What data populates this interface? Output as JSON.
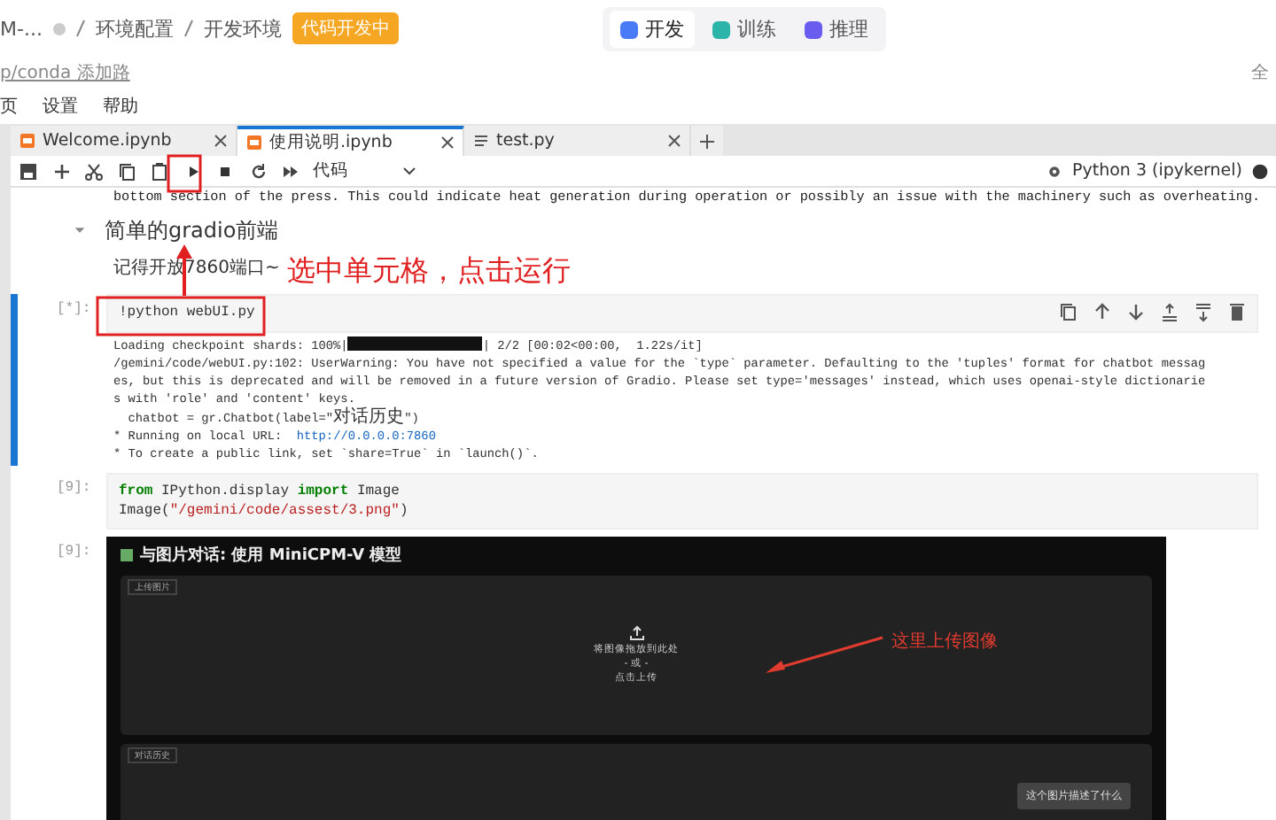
{
  "header": {
    "project": "M-...",
    "breadcrumbs": [
      "环境配置",
      "开发环境"
    ],
    "status_badge": "代码开发中",
    "modes": [
      {
        "label": "开发",
        "selected": true
      },
      {
        "label": "训练",
        "selected": false
      },
      {
        "label": "推理",
        "selected": false
      }
    ]
  },
  "env_link": "p/conda 添加路",
  "right_edge_label": "全",
  "menu": [
    "页",
    "设置",
    "帮助"
  ],
  "tabs": [
    {
      "label": "Welcome.ipynb",
      "kind": "notebook",
      "selected": false
    },
    {
      "label": "使用说明.ipynb",
      "kind": "notebook",
      "selected": true
    },
    {
      "label": "test.py",
      "kind": "file",
      "selected": false
    }
  ],
  "toolbar": {
    "cell_type": "代码",
    "kernel": "Python 3 (ipykernel)"
  },
  "notebook": {
    "prev_output": "bottom section of the press. This could indicate heat generation during operation or possibly an issue with the machinery such as overheating.",
    "heading": "简单的gradio前端",
    "note": "记得开放7860端口~",
    "run_cell": {
      "prompt": "[*]:",
      "code": "!python webUI.py",
      "selected": true,
      "output": [
        [
          {
            "kind": "text",
            "text": "Loading checkpoint shards: 100%|"
          },
          {
            "kind": "bar",
            "level": 1
          },
          {
            "kind": "text",
            "text": "| 2/2 [00:02<00:00,  1.22s/it]"
          }
        ],
        [
          {
            "kind": "text",
            "text": "/gemini/code/webUI.py:102: UserWarning: You have not specified a value for the `type` parameter. Defaulting to the 'tuples' format for chatbot messag"
          }
        ],
        [
          {
            "kind": "text",
            "text": "es, but this is deprecated and will be removed in a future version of Gradio. Please set type='messages' instead, which uses openai-style dictionarie"
          }
        ],
        [
          {
            "kind": "text",
            "text": "s with 'role' and 'content' keys."
          }
        ],
        [
          {
            "kind": "text",
            "text": "  chatbot = gr.Chatbot(label=\""
          },
          {
            "kind": "cjk",
            "text": "对话历史"
          },
          {
            "kind": "text",
            "text": "\")"
          }
        ],
        [
          {
            "kind": "text",
            "text": "* Running on local URL:  "
          },
          {
            "kind": "link",
            "text": "http://0.0.0.0:7860"
          }
        ],
        [
          {
            "kind": "text",
            "text": "* To create a public link, set `share=True` in `launch()`."
          }
        ]
      ]
    },
    "image_cell": {
      "prompt": "[9]:",
      "output_prompt": "[9]:",
      "code": [
        [
          {
            "kind": "keyword",
            "text": "from"
          },
          {
            "kind": "plain",
            "text": " IPython.display "
          },
          {
            "kind": "keyword",
            "text": "import"
          },
          {
            "kind": "plain",
            "text": " Image"
          }
        ],
        [
          {
            "kind": "plain",
            "text": "Image("
          },
          {
            "kind": "string",
            "text": "\"/gemini/code/assest/3.png\""
          },
          {
            "kind": "plain",
            "text": ")"
          }
        ]
      ],
      "screenshot": {
        "title": "与图片对话: 使用 MiniCPM-V 模型",
        "upload_label": "上传图片",
        "drop_text": "将图像拖放到此处",
        "or_text": "- 或 -",
        "click_text": "点击上传",
        "history_label": "对话历史",
        "user_message": "这个图片描述了什么",
        "annotation": "这里上传图像"
      }
    }
  },
  "annotation": {
    "text": "选中单元格，点击运行"
  }
}
